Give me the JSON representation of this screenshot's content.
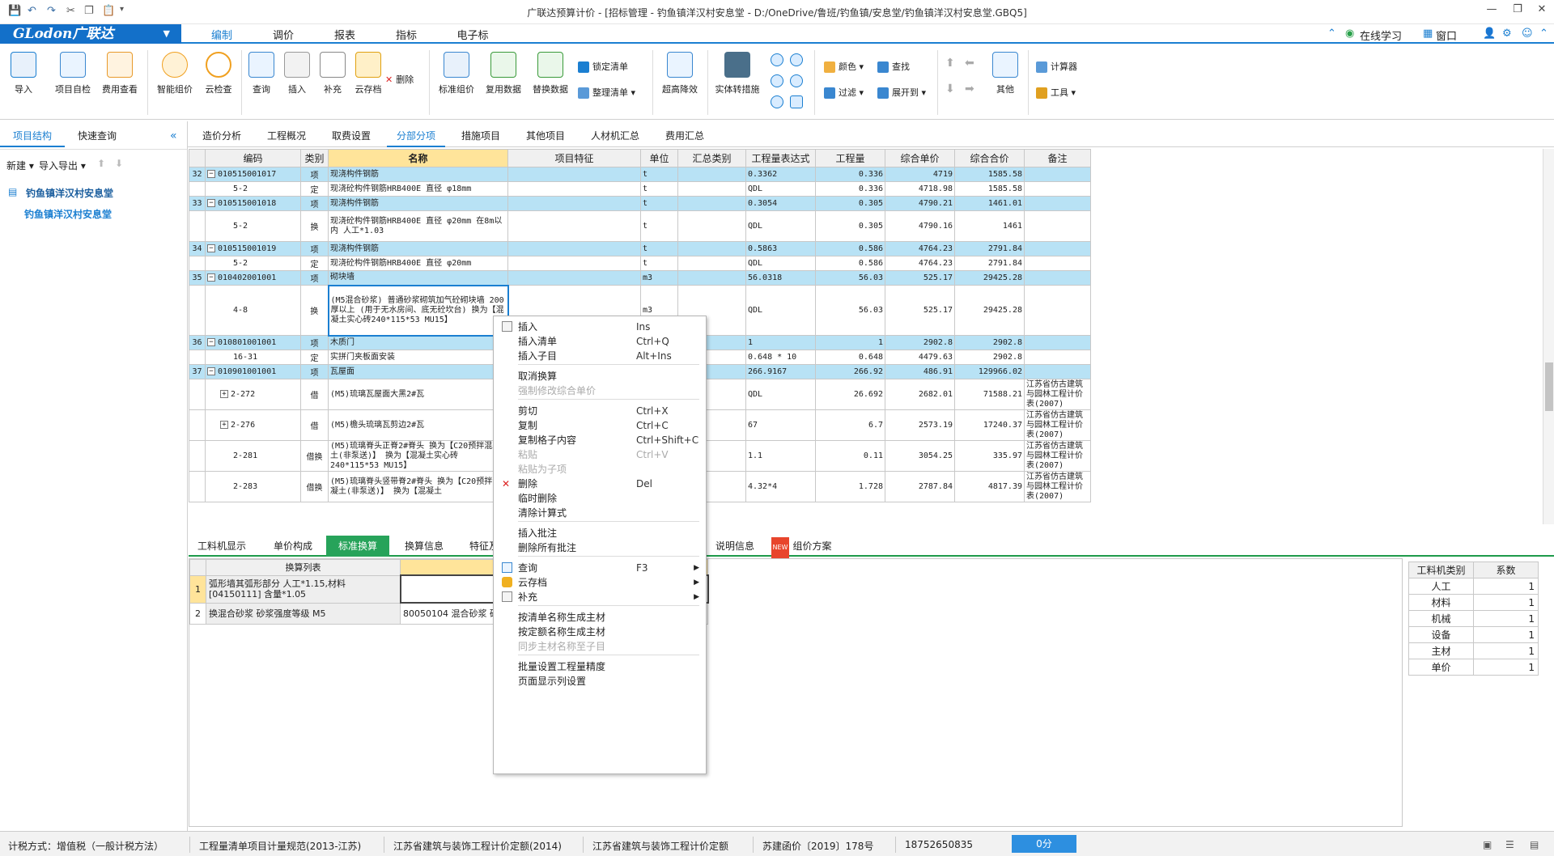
{
  "window": {
    "title": "广联达预算计价 - [招标管理 - 钓鱼镇洋汉村安息堂 - D:/OneDrive/鲁班/钓鱼镇/安息堂/钓鱼镇洋汉村安息堂.GBQ5]",
    "controls": [
      "—",
      "❐",
      "✕"
    ]
  },
  "menubar": {
    "logo": "GLodon广联达",
    "tabs": [
      "编制",
      "调价",
      "报表",
      "指标",
      "电子标"
    ],
    "active_tab": "编制",
    "right": {
      "online": "在线学习",
      "window": "窗口"
    }
  },
  "ribbon": {
    "big_buttons": [
      {
        "label": "导入",
        "icon": "import-icon"
      },
      {
        "label": "项目自检",
        "icon": "check-icon"
      },
      {
        "label": "费用查看",
        "icon": "cost-view-icon"
      },
      {
        "label": "智能组价",
        "icon": "smart-price-icon"
      },
      {
        "label": "云检查",
        "icon": "cloud-check-icon"
      },
      {
        "label": "查询",
        "icon": "query-icon"
      },
      {
        "label": "插入",
        "icon": "insert-icon"
      },
      {
        "label": "补充",
        "icon": "supplement-icon"
      },
      {
        "label": "云存档",
        "icon": "cloud-archive-icon"
      },
      {
        "label": "标准组价",
        "icon": "standard-price-icon"
      },
      {
        "label": "复用数据",
        "icon": "reuse-data-icon"
      },
      {
        "label": "替换数据",
        "icon": "replace-data-icon"
      },
      {
        "label": "超高降效",
        "icon": "high-efficiency-icon"
      },
      {
        "label": "实体转措施",
        "icon": "entity-measure-icon"
      },
      {
        "label": "其他",
        "icon": "other-icon"
      }
    ],
    "delete_label": "删除",
    "lock_label": "锁定清单",
    "organize_label": "整理清单",
    "color_label": "颜色",
    "find_label": "查找",
    "filter_label": "过滤",
    "expand_label": "展开到",
    "calculator_label": "计算器",
    "tools_label": "工具"
  },
  "left_panel": {
    "tabs": [
      "项目结构",
      "快速查询"
    ],
    "new_label": "新建",
    "import_export_label": "导入导出",
    "tree_root": "钓鱼镇洋汉村安息堂",
    "tree_child": "钓鱼镇洋汉村安息堂"
  },
  "top_tabs": [
    "造价分析",
    "工程概况",
    "取费设置",
    "分部分项",
    "措施项目",
    "其他项目",
    "人材机汇总",
    "费用汇总"
  ],
  "active_top_tab": "分部分项",
  "grid": {
    "columns": [
      "",
      "编码",
      "类别",
      "名称",
      "项目特征",
      "单位",
      "汇总类别",
      "工程量表达式",
      "工程量",
      "综合单价",
      "综合合价",
      "备注"
    ],
    "rows": [
      {
        "no": "32",
        "code": "010515001017",
        "type": "项",
        "name": "现浇构件钢筋",
        "unit": "t",
        "expr": "0.3362",
        "qty": "0.336",
        "price": "4719",
        "total": "1585.58",
        "remark": "",
        "qd": true
      },
      {
        "no": "",
        "code": "5-2",
        "type": "定",
        "name": "现浇砼构件钢筋HRB400E 直径 φ18mm",
        "unit": "t",
        "expr": "QDL",
        "qty": "0.336",
        "price": "4718.98",
        "total": "1585.58",
        "remark": "",
        "qd": false
      },
      {
        "no": "33",
        "code": "010515001018",
        "type": "项",
        "name": "现浇构件钢筋",
        "unit": "t",
        "expr": "0.3054",
        "qty": "0.305",
        "price": "4790.21",
        "total": "1461.01",
        "remark": "",
        "qd": true
      },
      {
        "no": "",
        "code": "5-2",
        "type": "换",
        "name": "现浇砼构件钢筋HRB400E 直径 φ20mm 在8m以内 人工*1.03",
        "unit": "t",
        "expr": "QDL",
        "qty": "0.305",
        "price": "4790.16",
        "total": "1461",
        "remark": "",
        "qd": false
      },
      {
        "no": "34",
        "code": "010515001019",
        "type": "项",
        "name": "现浇构件钢筋",
        "unit": "t",
        "expr": "0.5863",
        "qty": "0.586",
        "price": "4764.23",
        "total": "2791.84",
        "remark": "",
        "qd": true
      },
      {
        "no": "",
        "code": "5-2",
        "type": "定",
        "name": "现浇砼构件钢筋HRB400E 直径 φ20mm",
        "unit": "t",
        "expr": "QDL",
        "qty": "0.586",
        "price": "4764.23",
        "total": "2791.84",
        "remark": "",
        "qd": false
      },
      {
        "no": "35",
        "code": "010402001001",
        "type": "项",
        "name": "砌块墙",
        "unit": "m3",
        "expr": "56.0318",
        "qty": "56.03",
        "price": "525.17",
        "total": "29425.28",
        "remark": "",
        "qd": true
      },
      {
        "no": "",
        "code": "4-8",
        "type": "换",
        "name": "(M5混合砂浆) 普通砂浆砌筑加气砼砌块墙 200厚以上 (用于无水房间、底无砼坎台) 换为【混凝土实心砖240*115*53 MU15】",
        "unit": "m3",
        "expr": "QDL",
        "qty": "56.03",
        "price": "525.17",
        "total": "29425.28",
        "remark": "",
        "qd": false
      },
      {
        "no": "36",
        "code": "010801001001",
        "type": "项",
        "name": "木质门",
        "unit": "",
        "expr": "1",
        "qty": "1",
        "price": "2902.8",
        "total": "2902.8",
        "remark": "",
        "qd": true
      },
      {
        "no": "",
        "code": "16-31",
        "type": "定",
        "name": "实拼门夹板面安装",
        "unit": "",
        "expr": "0.648 * 10",
        "qty": "0.648",
        "price": "4479.63",
        "total": "2902.8",
        "remark": "",
        "qd": false
      },
      {
        "no": "37",
        "code": "010901001001",
        "type": "项",
        "name": "瓦屋面",
        "unit": "",
        "expr": "266.9167",
        "qty": "266.92",
        "price": "486.91",
        "total": "129966.02",
        "remark": "",
        "qd": true
      },
      {
        "no": "",
        "code": "2-272",
        "type": "借",
        "name": "(M5)琉璃瓦屋面大黑2#瓦",
        "unit": "",
        "expr": "QDL",
        "qty": "26.692",
        "price": "2682.01",
        "total": "71588.21",
        "remark": "江苏省仿古建筑与园林工程计价表(2007)",
        "qd": false
      },
      {
        "no": "",
        "code": "2-276",
        "type": "借",
        "name": "(M5)檐头琉璃瓦剪边2#瓦",
        "unit": "",
        "expr": "67",
        "qty": "6.7",
        "price": "2573.19",
        "total": "17240.37",
        "remark": "江苏省仿古建筑与园林工程计价表(2007)",
        "qd": false
      },
      {
        "no": "",
        "code": "2-281",
        "type": "借换",
        "name": "(M5)琉璃脊头正脊2#脊头 换为【C20预拌混凝土(非泵送)】 换为【混凝土实心砖240*115*53 MU15】",
        "unit": "",
        "expr": "1.1",
        "qty": "0.11",
        "price": "3054.25",
        "total": "335.97",
        "remark": "江苏省仿古建筑与园林工程计价表(2007)",
        "qd": false
      },
      {
        "no": "",
        "code": "2-283",
        "type": "借换",
        "name": "(M5)琉璃脊头竖带脊2#脊头 换为【C20预拌混凝土(非泵送)】 换为【混凝土",
        "unit": "",
        "expr": "4.32*4",
        "qty": "1.728",
        "price": "2787.84",
        "total": "4817.39",
        "remark": "江苏省仿古建筑与园林工程计价表(2007)",
        "qd": false
      }
    ]
  },
  "bottom_tabs": [
    "工料机显示",
    "单价构成",
    "标准换算",
    "换算信息",
    "特征及内容",
    "说明信息",
    "组价方案"
  ],
  "active_bottom_tab": "标准换算",
  "conversion": {
    "header_list": "换算列表",
    "header_content": "换算内容",
    "rows": [
      {
        "no": "1",
        "name": "弧形墙其弧形部分 人工*1.15,材料[04150111] 含量*1.05",
        "content": ""
      },
      {
        "no": "2",
        "name": "换混合砂浆 砂浆强度等级 M5",
        "content": "80050104 混合砂浆 砂浆强度等级 M5"
      }
    ]
  },
  "coefficients": {
    "header_type": "工料机类别",
    "header_coef": "系数",
    "rows": [
      {
        "type": "人工",
        "coef": "1"
      },
      {
        "type": "材料",
        "coef": "1"
      },
      {
        "type": "机械",
        "coef": "1"
      },
      {
        "type": "设备",
        "coef": "1"
      },
      {
        "type": "主材",
        "coef": "1"
      },
      {
        "type": "单价",
        "coef": "1"
      }
    ]
  },
  "context_menu": [
    {
      "label": "插入",
      "shortcut": "Ins",
      "enabled": true,
      "icon": "insert-icon"
    },
    {
      "label": "插入清单",
      "shortcut": "Ctrl+Q",
      "enabled": true
    },
    {
      "label": "插入子目",
      "shortcut": "Alt+Ins",
      "enabled": true
    },
    {
      "sep": true
    },
    {
      "label": "取消换算",
      "shortcut": "",
      "enabled": true
    },
    {
      "label": "强制修改综合单价",
      "shortcut": "",
      "enabled": false
    },
    {
      "sep": true
    },
    {
      "label": "剪切",
      "shortcut": "Ctrl+X",
      "enabled": true
    },
    {
      "label": "复制",
      "shortcut": "Ctrl+C",
      "enabled": true
    },
    {
      "label": "复制格子内容",
      "shortcut": "Ctrl+Shift+C",
      "enabled": true
    },
    {
      "label": "粘贴",
      "shortcut": "Ctrl+V",
      "enabled": false
    },
    {
      "label": "粘贴为子项",
      "shortcut": "",
      "enabled": false
    },
    {
      "label": "删除",
      "shortcut": "Del",
      "enabled": true,
      "icon": "delete-icon"
    },
    {
      "label": "临时删除",
      "shortcut": "",
      "enabled": true
    },
    {
      "label": "清除计算式",
      "shortcut": "",
      "enabled": true
    },
    {
      "sep": true
    },
    {
      "label": "插入批注",
      "shortcut": "",
      "enabled": true
    },
    {
      "label": "删除所有批注",
      "shortcut": "",
      "enabled": true
    },
    {
      "sep": true
    },
    {
      "label": "查询",
      "shortcut": "F3",
      "enabled": true,
      "submenu": true,
      "icon": "query-icon"
    },
    {
      "label": "云存档",
      "shortcut": "",
      "enabled": true,
      "submenu": true,
      "icon": "cloud-archive-icon"
    },
    {
      "label": "补充",
      "shortcut": "",
      "enabled": true,
      "submenu": true,
      "icon": "supplement-icon"
    },
    {
      "sep": true
    },
    {
      "label": "按清单名称生成主材",
      "shortcut": "",
      "enabled": true
    },
    {
      "label": "按定额名称生成主材",
      "shortcut": "",
      "enabled": true
    },
    {
      "label": "同步主材名称至子目",
      "shortcut": "",
      "enabled": false
    },
    {
      "sep": true
    },
    {
      "label": "批量设置工程量精度",
      "shortcut": "",
      "enabled": true
    },
    {
      "label": "页面显示列设置",
      "shortcut": "",
      "enabled": true
    }
  ],
  "status": {
    "method": "计税方式：增值税（一般计税方法）",
    "spec": "工程量清单项目计量规范(2013-江苏)",
    "quota1": "江苏省建筑与装饰工程计价定额(2014)",
    "quota2": "江苏省建筑与装饰工程计价定额",
    "doc": "苏建函价〔2019〕178号",
    "phone": "18752650835",
    "score": "0分"
  },
  "colors": {
    "accent": "#1b7fd1",
    "qd_row": "#b8e2f5",
    "green_tab": "#27a35a",
    "logo_bg": "#1370c9"
  }
}
